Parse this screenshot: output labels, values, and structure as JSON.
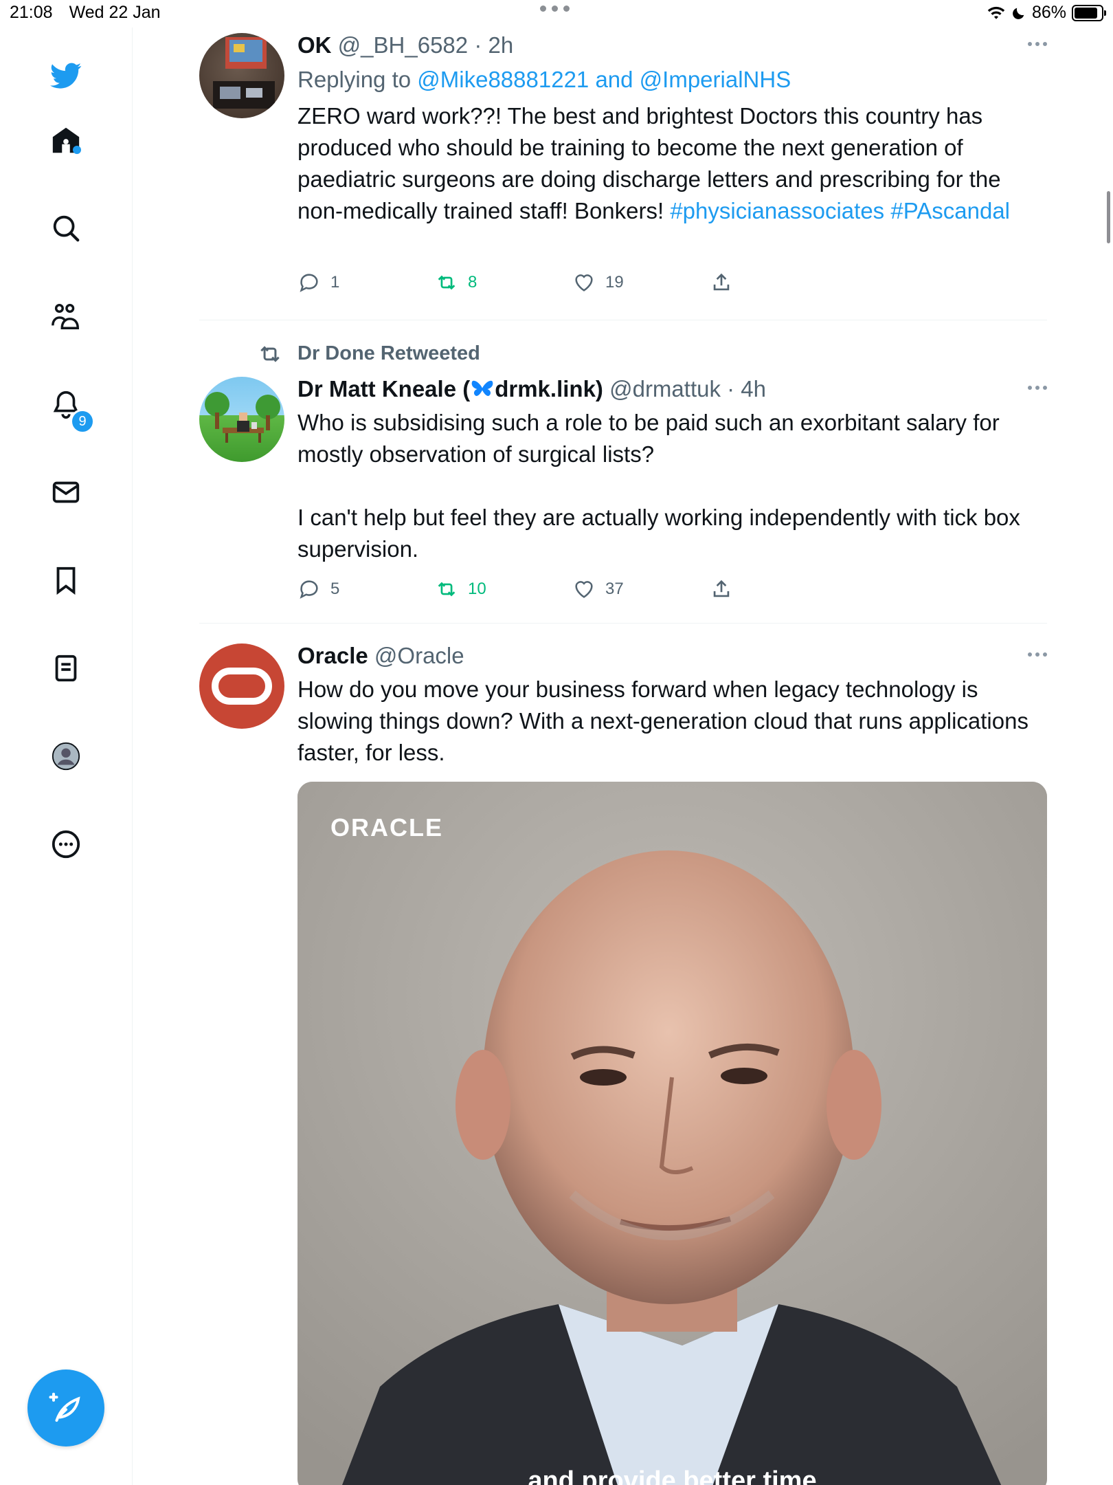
{
  "status_bar": {
    "time": "21:08",
    "date": "Wed 22 Jan",
    "battery": "86%",
    "battery_level": 0.86
  },
  "sidebar": {
    "items": [
      {
        "name": "home"
      },
      {
        "name": "search"
      },
      {
        "name": "communities"
      },
      {
        "name": "notifications",
        "badge": "9"
      },
      {
        "name": "messages"
      },
      {
        "name": "bookmarks"
      },
      {
        "name": "lists"
      },
      {
        "name": "profile"
      },
      {
        "name": "more"
      }
    ]
  },
  "tweets": [
    {
      "name": "OK",
      "handle": "@_BH_6582",
      "time": "· 2h",
      "replying_prefix": "Replying to",
      "replying_to": "@Mike88881221 and @ImperialNHS",
      "text": "ZERO ward work??! The best and brightest Doctors this country has produced who should be training to become the next generation of paediatric surgeons are doing discharge letters and prescribing for the non-medically trained staff! Bonkers!",
      "hashtag1": "#physicianassociates",
      "hashtag2": "#PAscandal",
      "replies": "1",
      "retweets": "8",
      "likes": "19"
    },
    {
      "retweeted_by": "Dr Done Retweeted",
      "name_prefix": "Dr Matt Kneale (",
      "name_suffix": "drmk.link)",
      "handle": "@drmattuk",
      "time": "· 4h",
      "text1": "Who is subsidising such a role to be paid such an exorbitant salary for mostly observation of surgical lists?",
      "text2": "I can't help but feel they are actually working independently with tick box supervision.",
      "replies": "5",
      "retweets": "10",
      "likes": "37"
    },
    {
      "name": "Oracle",
      "handle": "@Oracle",
      "text": "How do you move your business forward when legacy technology is slowing things down? With a next-generation cloud that runs applications faster, for less.",
      "media_logo": "ORACLE",
      "media_caption": "and provide better time"
    }
  ],
  "colors": {
    "accent": "#1d9bf0",
    "retweet_green": "#00ba7c",
    "oracle_red": "#c74634",
    "muted": "#536471"
  }
}
